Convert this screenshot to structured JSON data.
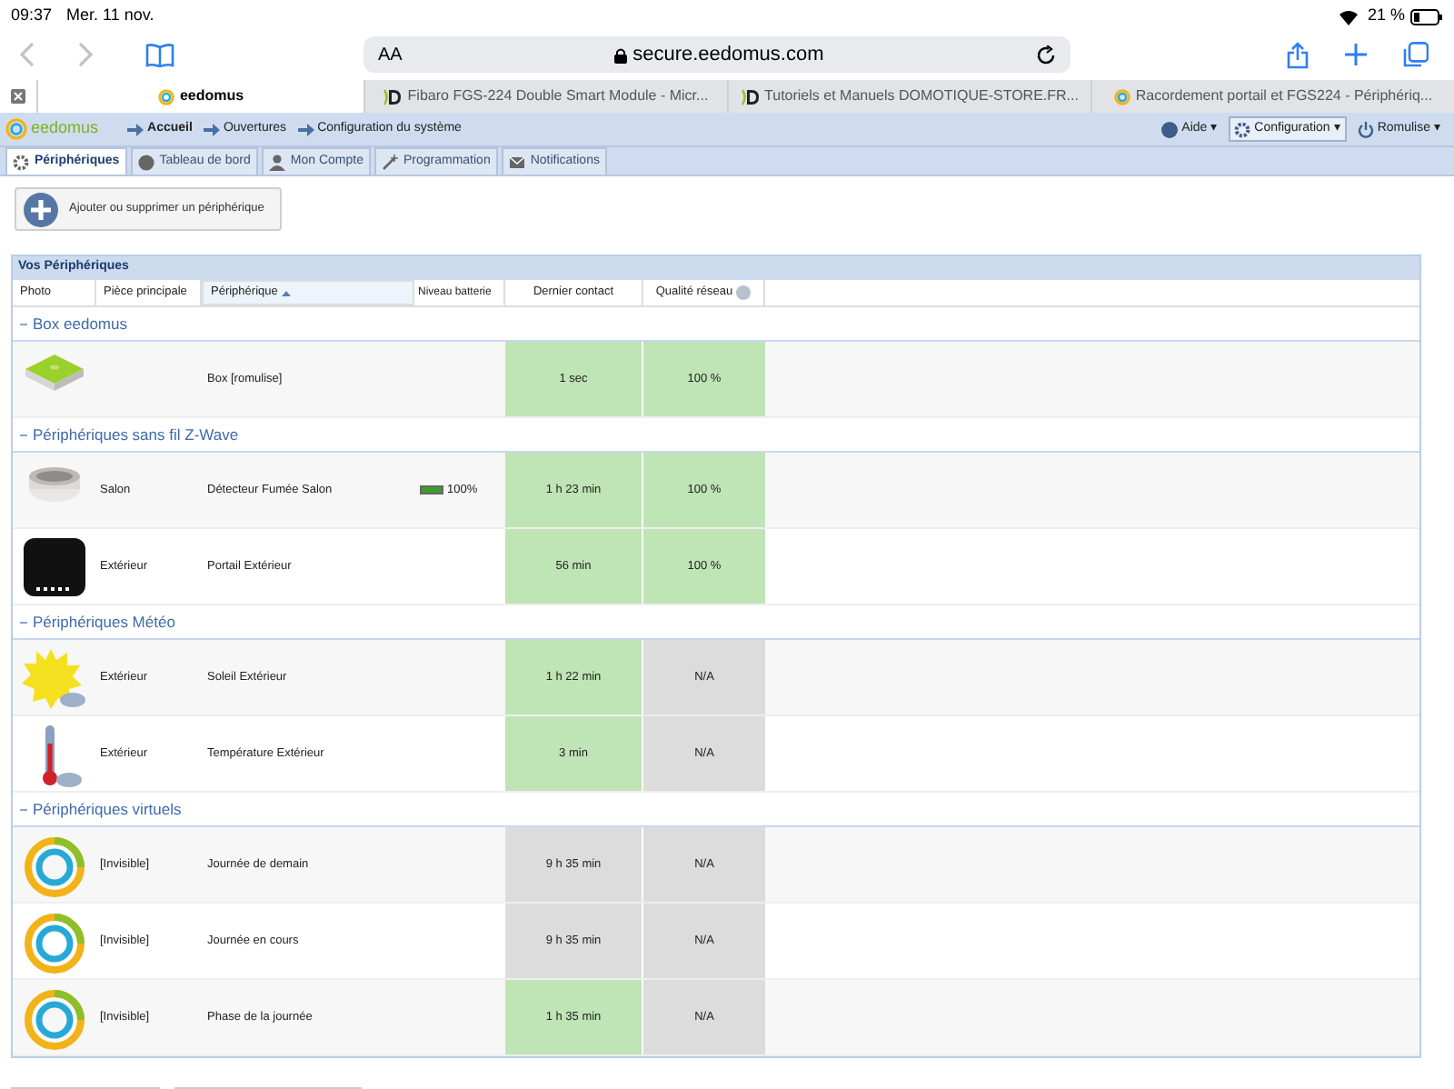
{
  "status_bar": {
    "time": "09:37",
    "date": "Mer. 11 nov.",
    "battery": "21 %"
  },
  "browser": {
    "address_prefix": "AA",
    "url": "secure.eedomus.com"
  },
  "browser_tabs": [
    {
      "label": "eedomus",
      "selected": true
    },
    {
      "label": "Fibaro FGS-224 Double Smart Module - Micr...",
      "selected": false
    },
    {
      "label": "Tutoriels et Manuels DOMOTIQUE-STORE.FR...",
      "selected": false
    },
    {
      "label": "Racordement portail et FGS224 - Périphériq...",
      "selected": false
    }
  ],
  "navbar": {
    "logo": "eedomus",
    "breadcrumbs": [
      "Accueil",
      "Ouvertures",
      "Configuration du système"
    ],
    "help": "Aide",
    "help_caret": "▾",
    "config": "Configuration",
    "config_caret": "▾",
    "user": "Romulise",
    "user_caret": "▾"
  },
  "tabs": [
    {
      "label": "Périphériques",
      "selected": true
    },
    {
      "label": "Tableau de bord",
      "selected": false
    },
    {
      "label": "Mon Compte",
      "selected": false
    },
    {
      "label": "Programmation",
      "selected": false
    },
    {
      "label": "Notifications",
      "selected": false
    }
  ],
  "add_button": "Ajouter ou supprimer un périphérique",
  "table": {
    "title": "Vos Périphériques",
    "columns": [
      {
        "label": "Photo",
        "sorted": false
      },
      {
        "label": "Pièce principale",
        "sorted": false
      },
      {
        "label": "Périphérique",
        "sorted": true
      },
      {
        "label": "Niveau batterie",
        "sorted": false
      },
      {
        "label": "Dernier contact",
        "sorted": false
      },
      {
        "label": "Qualité réseau",
        "sorted": false
      }
    ],
    "groups": [
      {
        "label": "Box eedomus",
        "rows": [
          {
            "kind": "box",
            "name": "Box [romulise]",
            "last_contact": "1 sec",
            "contact_ok": true,
            "quality": "100 %",
            "quality_ok": true
          }
        ]
      },
      {
        "label": "Périphériques sans fil Z-Wave",
        "rows": [
          {
            "kind": "smoke",
            "room": "Salon",
            "name": "Détecteur Fumée Salon",
            "battery": {
              "level": 1,
              "reading": "100%"
            },
            "last_contact": "1 h 23 min",
            "contact_ok": true,
            "quality": "100 %",
            "quality_ok": true
          },
          {
            "kind": "switch",
            "room": "Extérieur",
            "name": "Portail Extérieur",
            "last_contact": "56 min",
            "contact_ok": true,
            "quality": "100 %",
            "quality_ok": true
          }
        ]
      },
      {
        "label": "Périphériques Météo",
        "rows": [
          {
            "kind": "sun",
            "room": "Extérieur",
            "name": "Soleil Extérieur",
            "last_contact": "1 h 22 min",
            "contact_ok": true,
            "quality": "N/A",
            "quality_ok": false
          },
          {
            "kind": "thermometer",
            "room": "Extérieur",
            "name": "Température Extérieur",
            "last_contact": "3 min",
            "contact_ok": true,
            "quality": "N/A",
            "quality_ok": false
          }
        ]
      },
      {
        "label": "Périphériques virtuels",
        "rows": [
          {
            "kind": "virtual",
            "room": "[Invisible]",
            "name": "Journée de demain",
            "last_contact": "9 h 35 min",
            "contact_ok": false,
            "quality": "N/A",
            "quality_ok": false
          },
          {
            "kind": "virtual",
            "room": "[Invisible]",
            "name": "Journée en cours",
            "last_contact": "9 h 35 min",
            "contact_ok": false,
            "quality": "N/A",
            "quality_ok": false
          },
          {
            "kind": "virtual",
            "room": "[Invisible]",
            "name": "Phase de la journée",
            "last_contact": "1 h 35 min",
            "contact_ok": true,
            "quality": "N/A",
            "quality_ok": false
          }
        ]
      }
    ]
  }
}
